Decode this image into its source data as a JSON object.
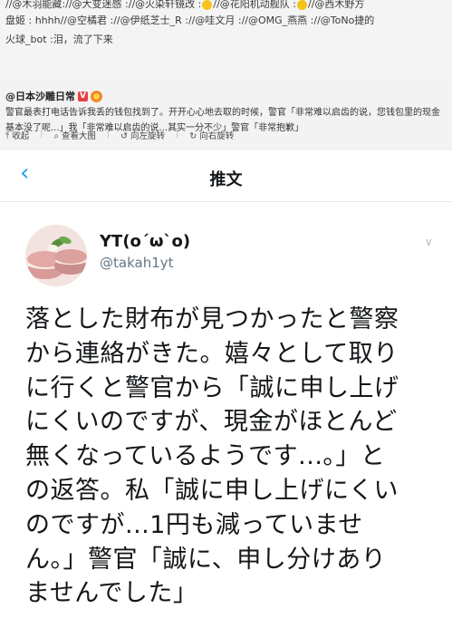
{
  "weibo_top": {
    "line1": "//@木羽能藏://@大变迷感 ://@火染轩镜改 :",
    "line1b": "//@花阳机动舰队 :",
    "line1c": "//@西木野方",
    "line2": "盘姬 : hhhh//@空橘君 ://@伊纸芝士_R ://@哇文月 ://@OMG_燕燕 ://@ToNo捷的",
    "line3": "火球_bot :泪，流了下来"
  },
  "weibo_post": {
    "author": "@日本沙雕日常",
    "verified_badge": "V",
    "body": "警官最表打电话告诉我丢的钱包找到了。开开心心地去取的时候，警官「非常难以启齿的说，您钱包里的现金基本没了呢...」我「非常难以启齿的说...其实一分不少」警官「非常抱歉」",
    "actions": [
      {
        "icon": "collapse-icon",
        "glyph": "⤒",
        "label": "收起"
      },
      {
        "icon": "magnifier-icon",
        "glyph": "⌕",
        "label": "查看大图"
      },
      {
        "icon": "rotate-left-icon",
        "glyph": "↺",
        "label": "向左旋转"
      },
      {
        "icon": "rotate-right-icon",
        "glyph": "↻",
        "label": "向右旋转"
      }
    ]
  },
  "tweet_card": {
    "back_glyph": "‹",
    "title": "推文",
    "user_name": "YT(o´ω`o)",
    "user_handle": "@takah1yt",
    "more_glyph": "∨",
    "text_lines": [
      "落とした財布が見つかったと警察",
      "から連絡がきた。嬉々として取り",
      "に行くと警官から「誠に申し上げ",
      "にくいのですが、現金がほとんど",
      "無くなっているようです...。」と",
      "の返答。私「誠に申し上げにくい",
      "のですが...1円も減っていませ",
      "ん。」警官「誠に、申し分けあり",
      "ませんでした」"
    ]
  },
  "colors": {
    "twitter_blue": "#1da1f2",
    "verified_red": "#e64141"
  }
}
